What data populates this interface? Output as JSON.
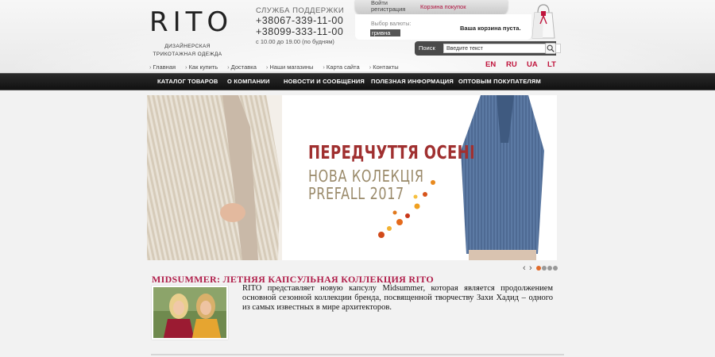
{
  "logo": {
    "brand": "RITO",
    "tagline": "ДИЗАЙНЕРСКАЯ ТРИКОТАЖНАЯ ОДЕЖДА"
  },
  "support": {
    "title": "СЛУЖБА ПОДДЕРЖКИ",
    "phone1": "+38067-339-11-00",
    "phone2": "+38099-333-11-00",
    "hours": "с 10.00 до 19.00 (по будням)"
  },
  "account": {
    "login": "Войти",
    "register": "регистрация",
    "cart_link": "Корзина покупок"
  },
  "currency": {
    "label": "Выбор валюты:",
    "selected": "гривна"
  },
  "cart": {
    "status": "Ваша корзина пуста."
  },
  "search": {
    "label": "Поиск",
    "placeholder": "Введите текст"
  },
  "languages": [
    "EN",
    "RU",
    "UA",
    "LT"
  ],
  "top_links": [
    "Главная",
    "Как купить",
    "Доставка",
    "Наши магазины",
    "Карта сайта",
    "Контакты"
  ],
  "main_nav": [
    "КАТАЛОГ ТОВАРОВ",
    "О КОМПАНИИ",
    "НОВОСТИ И СООБЩЕНИЯ",
    "ПОЛЕЗНАЯ ИНФОРМАЦИЯ",
    "ОПТОВЫМ ПОКУПАТЕЛЯМ"
  ],
  "banner": {
    "title": "ПЕРЕДЧУТТЯ ОСЕНІ",
    "line1": "НОВА КОЛЕКЦІЯ",
    "line2": "PREFALL 2017",
    "active_slide": 1,
    "slide_count": 4
  },
  "article": {
    "title": "MIDSUMMER: ЛЕТНЯЯ КАПСУЛЬНАЯ КОЛЛЕКЦИЯ RITO",
    "text": "RITO представляет новую капсулу Midsummer, которая является продолжением основной сезонной коллекции бренда, посвященной творчеству Захи Хадид – одного из самых известных в мире архитекторов."
  },
  "colors": {
    "accent": "#c0143c",
    "nav_bg": "#1a1a1a",
    "banner_title": "#a03030"
  }
}
